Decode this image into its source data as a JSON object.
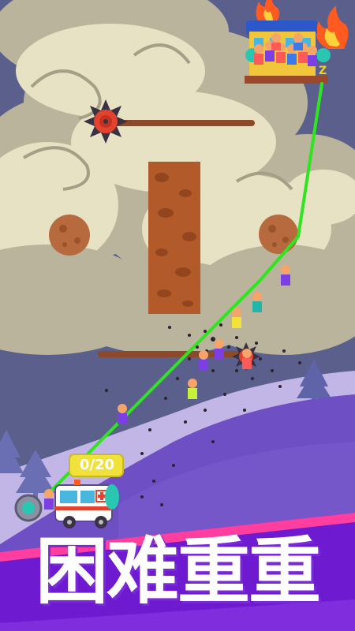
{
  "level": {
    "rescued_counter": "0/20"
  },
  "banner": {
    "title": "困难重重"
  },
  "colors": {
    "sky": "#5b5f8c",
    "cloud_dark": "#b9b49b",
    "cloud_light": "#e7e2c4",
    "hill_back": "#c1b6e6",
    "hill_front": "#6f50c4",
    "rope": "#2ee51f",
    "dirt": "#b35a2b",
    "banner_purple": "#6d1ad1",
    "banner_pink": "#ff3ea0"
  },
  "icons": [
    "spiked-saw-icon",
    "fire-icon",
    "tree-icon",
    "ambulance-icon",
    "building-icon"
  ]
}
